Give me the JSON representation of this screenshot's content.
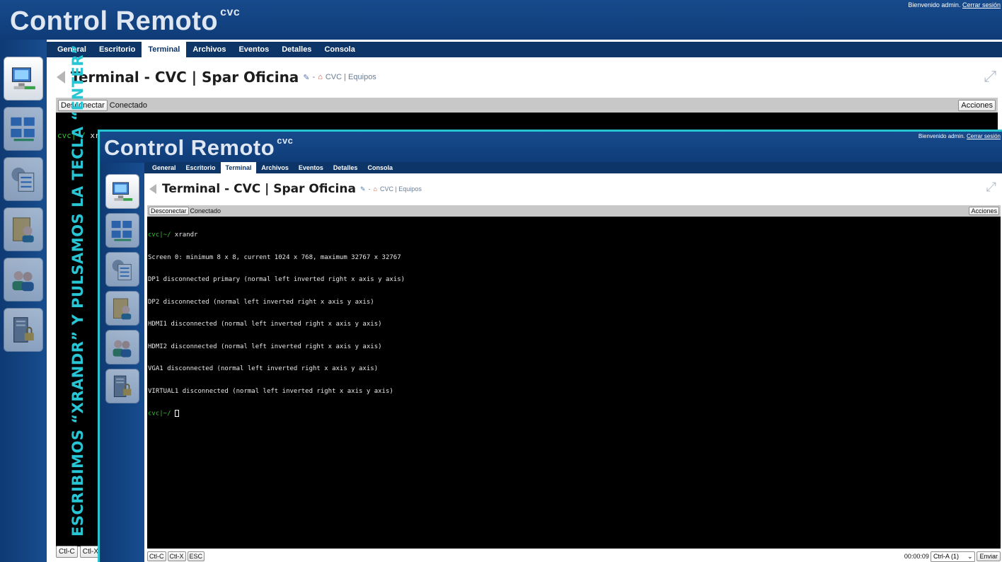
{
  "app": {
    "name": "Control Remoto",
    "sup": "cvc",
    "welcome_prefix": "Bienvenido admin.",
    "logout": "Cerrar sesión"
  },
  "tabs": [
    {
      "label": "General"
    },
    {
      "label": "Escritorio"
    },
    {
      "label": "Terminal"
    },
    {
      "label": "Archivos"
    },
    {
      "label": "Eventos"
    },
    {
      "label": "Detalles"
    },
    {
      "label": "Consola"
    }
  ],
  "active_tab": "Terminal",
  "sidebar_icons": [
    "computer-icon",
    "computers-group-icon",
    "settings-list-icon",
    "user-folder-icon",
    "users-icon",
    "server-lock-icon"
  ],
  "page": {
    "title": "Terminal - CVC | Spar Oficina",
    "separator": "-",
    "crumb": "CVC | Equipos"
  },
  "toolbar": {
    "disconnect": "Desconectar",
    "status": "Conectado",
    "actions": "Acciones"
  },
  "terminal_before": {
    "prompt": "cvc|~/",
    "command": " xrandr"
  },
  "terminal_after": {
    "prompt": "cvc|~/",
    "command": " xrandr",
    "output": [
      "Screen 0: minimum 8 x 8, current 1024 x 768, maximum 32767 x 32767",
      "DP1 disconnected primary (normal left inverted right x axis y axis)",
      "DP2 disconnected (normal left inverted right x axis y axis)",
      "HDMI1 disconnected (normal left inverted right x axis y axis)",
      "HDMI2 disconnected (normal left inverted right x axis y axis)",
      "VGA1 disconnected (normal left inverted right x axis y axis)",
      "VIRTUAL1 disconnected (normal left inverted right x axis y axis)"
    ],
    "final_prompt": "cvc|~/"
  },
  "bottom": {
    "ctl_c": "Ctl-C",
    "ctl_x": "Ctl-X",
    "ctl_x_truncated": "Ctl-X",
    "esc": "ESC",
    "timer": "00:00:09",
    "select_value": "Ctrl-A (1)",
    "send": "Enviar"
  },
  "caption": "ESCRIBIMOS “XRANDR” Y PULSAMOS LA TECLA “ENTER”",
  "colors": {
    "header": "#174a8c",
    "tabbar": "#0e3568",
    "caption": "#28c5d4",
    "inner_border": "#27c3cf",
    "prompt": "#35c235"
  }
}
